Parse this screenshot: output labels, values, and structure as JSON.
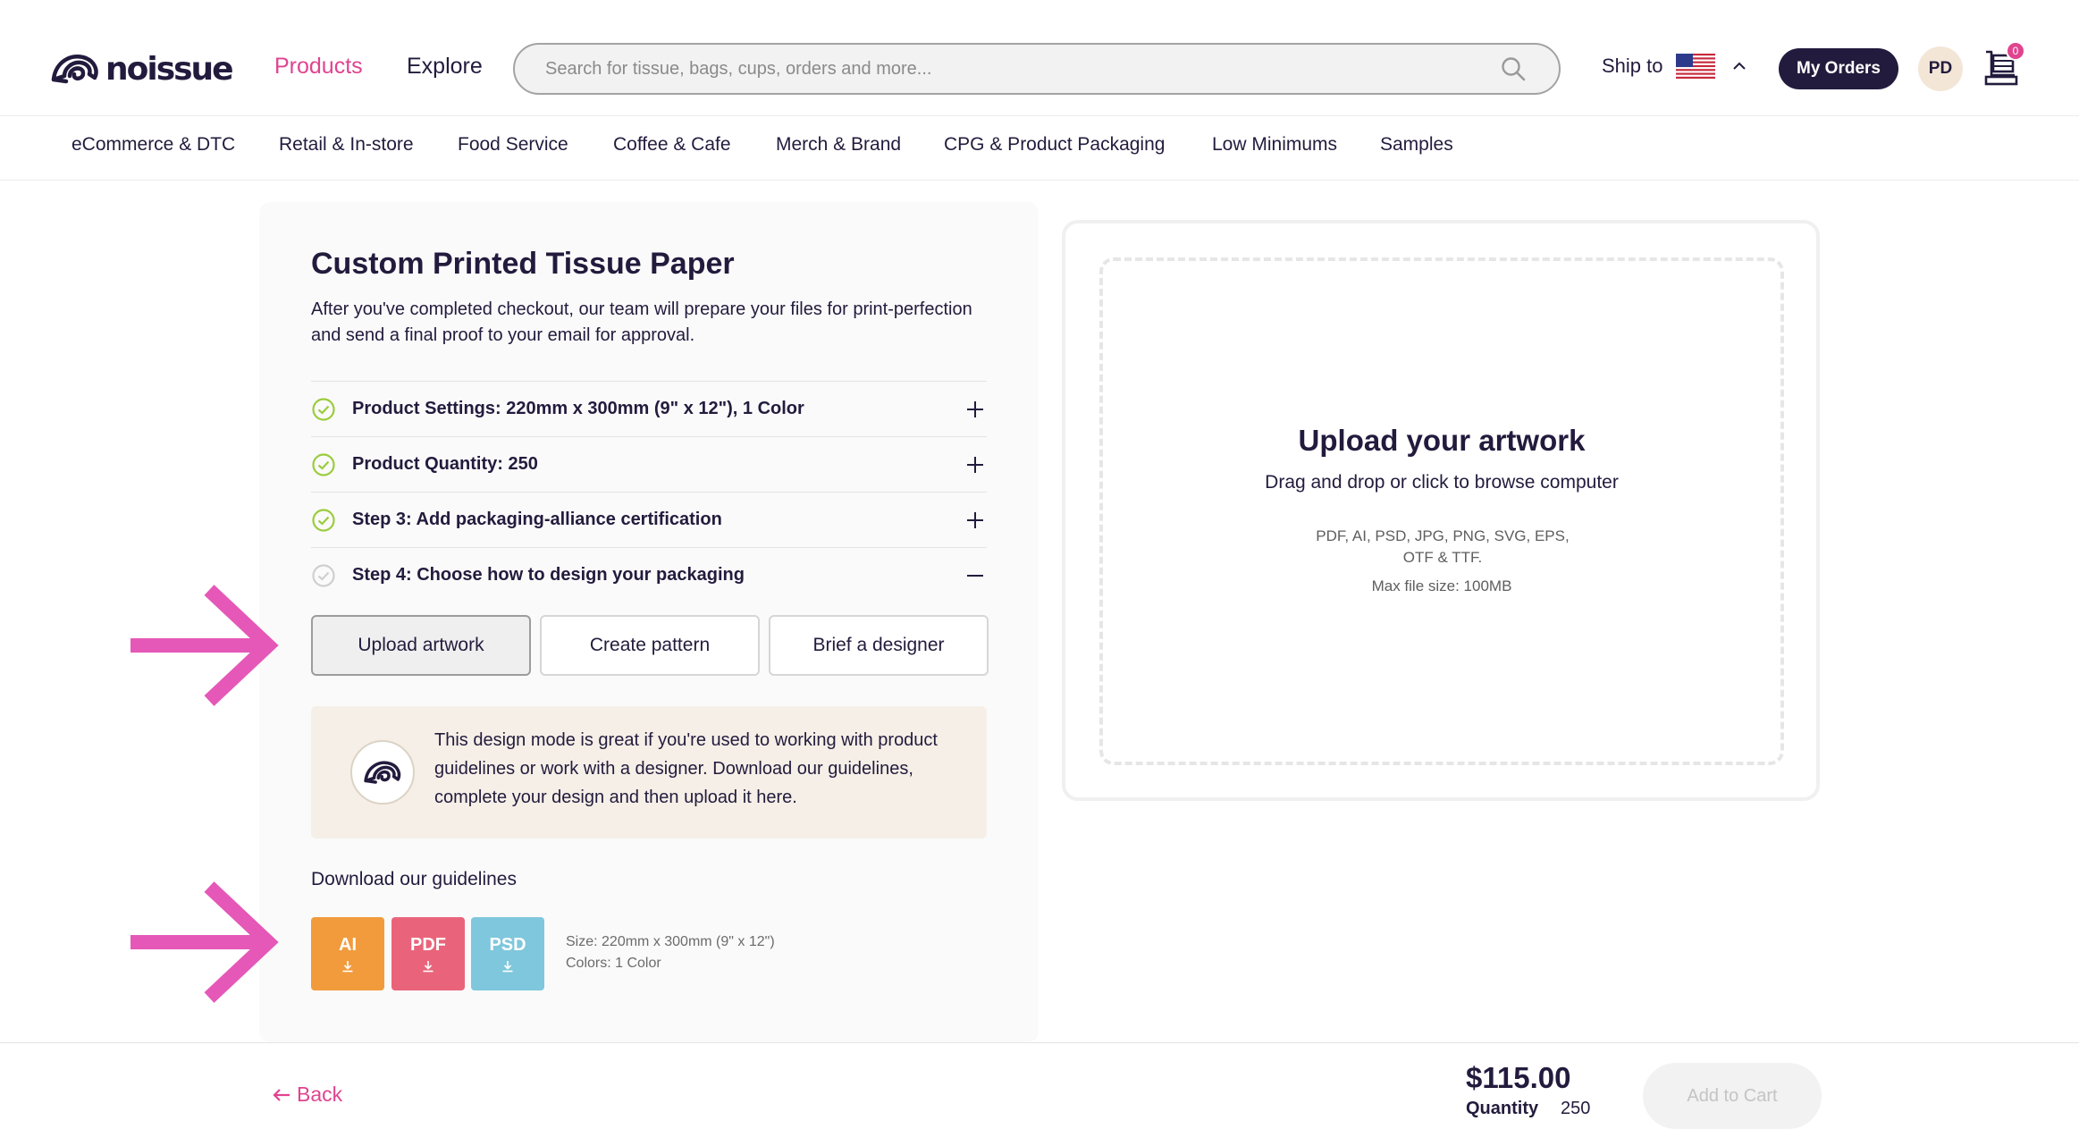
{
  "header": {
    "logo_text": "noissue",
    "nav_products": "Products",
    "nav_explore": "Explore",
    "search_placeholder": "Search for tissue, bags, cups, orders and more...",
    "ship_to_label": "Ship to",
    "ship_to_flag": "us-flag-icon",
    "my_orders_label": "My Orders",
    "avatar_initials": "PD",
    "cart_count": "0",
    "accent_color": "#e0448f",
    "brand_dark": "#231b3d"
  },
  "categories": [
    "eCommerce & DTC",
    "Retail & In-store",
    "Food Service",
    "Coffee & Cafe",
    "Merch & Brand",
    "CPG & Product Packaging",
    "Low Minimums",
    "Samples"
  ],
  "product": {
    "title": "Custom Printed Tissue Paper",
    "intro": "After you've completed checkout, our team will prepare your files for print-perfection and send a final proof to your email for approval.",
    "steps": [
      {
        "label": "Product Settings: 220mm x 300mm (9\" x 12\"), 1 Color",
        "status": "complete",
        "toggle": "+"
      },
      {
        "label": "Product Quantity: 250",
        "status": "complete",
        "toggle": "+"
      },
      {
        "label": "Step 3: Add packaging-alliance certification",
        "status": "complete",
        "toggle": "+"
      },
      {
        "label": "Step 4: Choose how to design your packaging",
        "status": "pending",
        "toggle": "−"
      }
    ],
    "design_modes": [
      "Upload artwork",
      "Create pattern",
      "Brief a designer"
    ],
    "selected_mode": "Upload artwork",
    "info_text": "This design mode is great if you're used to working with product guidelines or work with a designer. Download our guidelines, complete your design and then upload it here.",
    "guidelines_title": "Download our guidelines",
    "guideline_files": [
      {
        "label": "AI",
        "color": "#f19b3c"
      },
      {
        "label": "PDF",
        "color": "#e9647a"
      },
      {
        "label": "PSD",
        "color": "#7fc7dc"
      }
    ],
    "guideline_size": "Size: 220mm x 300mm (9\" x 12\")",
    "guideline_colors": "Colors: 1 Color"
  },
  "upload": {
    "title": "Upload your artwork",
    "subtitle": "Drag and drop or click to browse computer",
    "formats": "PDF, AI, PSD, JPG, PNG, SVG, EPS, OTF & TTF.",
    "max_size": "Max file size: 100MB"
  },
  "footer": {
    "back_label": "Back",
    "price": "$115.00",
    "quantity_label": "Quantity",
    "quantity_value": "250",
    "add_to_cart_label": "Add to Cart"
  }
}
